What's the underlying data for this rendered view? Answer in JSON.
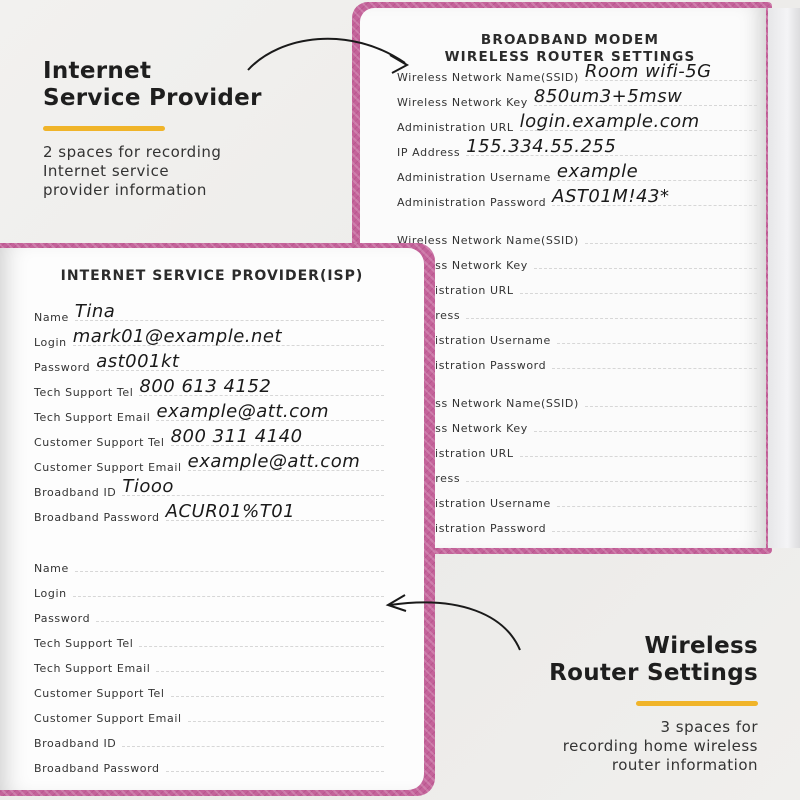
{
  "isp_callout": {
    "title_line1": "Internet",
    "title_line2": "Service Provider",
    "description_lines": [
      "2 spaces for recording",
      "Internet service",
      "provider information"
    ]
  },
  "router_callout": {
    "title_line1": "Wireless",
    "title_line2": "Router Settings",
    "description_lines": [
      "3 spaces for",
      "recording home wireless",
      "router information"
    ]
  },
  "colors": {
    "cover_pink": "#c4639a",
    "accent_yellow": "#f0b429",
    "page": "#fbfbfb",
    "background": "#efeeec"
  },
  "router_page": {
    "heading_line1": "BROADBAND MODEM",
    "heading_line2": "WIRELESS ROUTER SETTINGS",
    "sections": [
      {
        "fields": [
          {
            "label": "Wireless Network Name(SSID)",
            "value": "Room wifi-5G"
          },
          {
            "label": "Wireless Network Key",
            "value": "850um3+5msw"
          },
          {
            "label": "Administration URL",
            "value": "login.example.com"
          },
          {
            "label": "IP Address",
            "value": "155.334.55.255"
          },
          {
            "label": "Administration Username",
            "value": "example"
          },
          {
            "label": "Administration Password",
            "value": "AST01M!43*"
          }
        ]
      },
      {
        "fields": [
          {
            "label": "Wireless Network Name(SSID)",
            "value": ""
          },
          {
            "label": "Wireless Network Key",
            "value": ""
          },
          {
            "label": "Administration URL",
            "value": ""
          },
          {
            "label": "IP Address",
            "value": ""
          },
          {
            "label": "Administration Username",
            "value": ""
          },
          {
            "label": "Administration Password",
            "value": ""
          }
        ]
      },
      {
        "fields": [
          {
            "label": "Wireless Network Name(SSID)",
            "value": ""
          },
          {
            "label": "Wireless Network Key",
            "value": ""
          },
          {
            "label": "Administration URL",
            "value": ""
          },
          {
            "label": "IP Address",
            "value": ""
          },
          {
            "label": "Administration Username",
            "value": ""
          },
          {
            "label": "Administration Password",
            "value": ""
          }
        ]
      }
    ]
  },
  "isp_page": {
    "heading": "INTERNET SERVICE PROVIDER(ISP)",
    "sections": [
      {
        "fields": [
          {
            "label": "Name",
            "value": "Tina"
          },
          {
            "label": "Login",
            "value": "mark01@example.net"
          },
          {
            "label": "Password",
            "value": "ast001kt"
          },
          {
            "label": "Tech Support Tel",
            "value": "800 613 4152"
          },
          {
            "label": "Tech Support Email",
            "value": "example@att.com"
          },
          {
            "label": "Customer Support Tel",
            "value": "800 311 4140"
          },
          {
            "label": "Customer Support Email",
            "value": "example@att.com"
          },
          {
            "label": "Broadband ID",
            "value": "Tiooo"
          },
          {
            "label": "Broadband Password",
            "value": "ACUR01%T01"
          }
        ]
      },
      {
        "fields": [
          {
            "label": "Name",
            "value": ""
          },
          {
            "label": "Login",
            "value": ""
          },
          {
            "label": "Password",
            "value": ""
          },
          {
            "label": "Tech Support Tel",
            "value": ""
          },
          {
            "label": "Tech Support Email",
            "value": ""
          },
          {
            "label": "Customer Support Tel",
            "value": ""
          },
          {
            "label": "Customer Support Email",
            "value": ""
          },
          {
            "label": "Broadband ID",
            "value": ""
          },
          {
            "label": "Broadband Password",
            "value": ""
          }
        ]
      }
    ]
  }
}
